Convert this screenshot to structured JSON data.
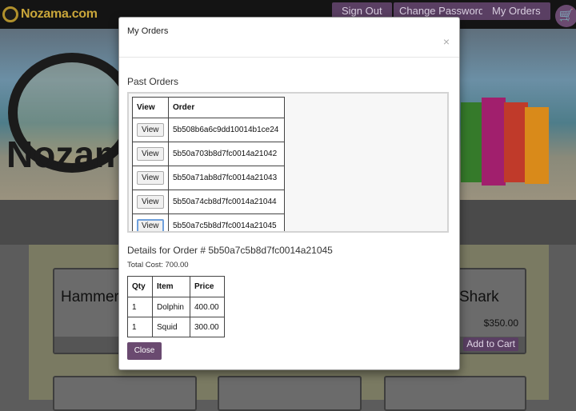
{
  "site": {
    "brand": "Nozama.com",
    "nav": {
      "sign_out": "Sign Out",
      "change_password": "Change Password",
      "my_orders": "My Orders"
    },
    "hero_logo_text": "Nozama"
  },
  "products": {
    "left_card": {
      "title": "Hammer"
    },
    "right_card": {
      "title": "Shark",
      "price": "$350.00",
      "add_to_cart": "Add to Cart"
    }
  },
  "modal": {
    "title": "My Orders",
    "close_icon": "×",
    "past_orders_heading": "Past Orders",
    "orders_table": {
      "headers": {
        "view": "View",
        "order": "Order"
      },
      "view_label": "View",
      "rows": [
        {
          "order_id": "5b508b6a6c9dd10014b1ce24"
        },
        {
          "order_id": "5b50a703b8d7fc0014a21042"
        },
        {
          "order_id": "5b50a71ab8d7fc0014a21043"
        },
        {
          "order_id": "5b50a74cb8d7fc0014a21044"
        },
        {
          "order_id": "5b50a7c5b8d7fc0014a21045"
        }
      ]
    },
    "details": {
      "heading": "Details for Order # 5b50a7c5b8d7fc0014a21045",
      "total_cost": "Total Cost: 700.00",
      "headers": {
        "qty": "Qty",
        "item": "Item",
        "price": "Price"
      },
      "items": [
        {
          "qty": "1",
          "item": "Dolphin",
          "price": "400.00"
        },
        {
          "qty": "1",
          "item": "Squid",
          "price": "300.00"
        }
      ]
    },
    "close_button": "Close"
  }
}
